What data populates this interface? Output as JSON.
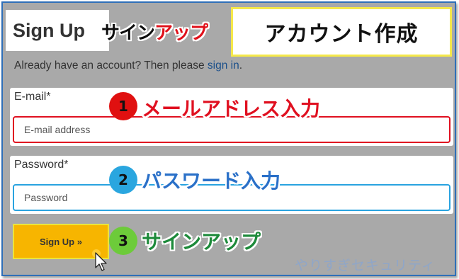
{
  "header": {
    "title": "Sign Up",
    "title_jp_black": "サイン",
    "title_jp_red": "アップ",
    "caption": "アカウント作成"
  },
  "signin_prompt": {
    "text": "Already have an account? Then please ",
    "link": "sign in",
    "suffix": "."
  },
  "email": {
    "label": "E-mail*",
    "placeholder": "E-mail address"
  },
  "password": {
    "label": "Password*",
    "placeholder": "Password"
  },
  "submit": {
    "label": "Sign Up »"
  },
  "annotations": [
    {
      "number": "1",
      "text": "メールアドレス入力",
      "color": "#e01020"
    },
    {
      "number": "2",
      "text": "パスワード入力",
      "color": "#2a70c8"
    },
    {
      "number": "3",
      "text": "サインアップ",
      "color": "#1d8a3a"
    }
  ],
  "watermark": "やりすぎセキュリティ",
  "colors": {
    "background": "#a9a9a9",
    "border": "#2f6fb8",
    "button": "#f7b500",
    "email_outline": "#e01020",
    "password_outline": "#29a3e0"
  },
  "icons": [
    "mouse-cursor-icon"
  ]
}
